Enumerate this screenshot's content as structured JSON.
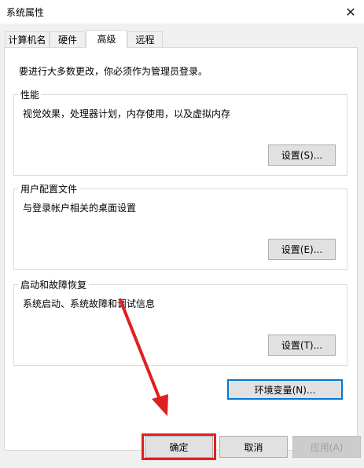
{
  "window": {
    "title": "系统属性",
    "close_glyph": "✕"
  },
  "tabs": [
    {
      "label": "计算机名",
      "active": false
    },
    {
      "label": "硬件",
      "active": false
    },
    {
      "label": "高级",
      "active": true
    },
    {
      "label": "远程",
      "active": false
    }
  ],
  "advanced": {
    "intro": "要进行大多数更改，你必须作为管理员登录。",
    "performance": {
      "title": "性能",
      "description": "视觉效果，处理器计划，内存使用，以及虚拟内存",
      "button": "设置(S)..."
    },
    "user_profiles": {
      "title": "用户配置文件",
      "description": "与登录帐户相关的桌面设置",
      "button": "设置(E)..."
    },
    "startup_recovery": {
      "title": "启动和故障恢复",
      "description": "系统启动、系统故障和调试信息",
      "button": "设置(T)..."
    },
    "env_button": "环境变量(N)..."
  },
  "footer": {
    "ok": "确定",
    "cancel": "取消",
    "apply": "应用(A)"
  },
  "annotation": {
    "color": "#e02020"
  }
}
